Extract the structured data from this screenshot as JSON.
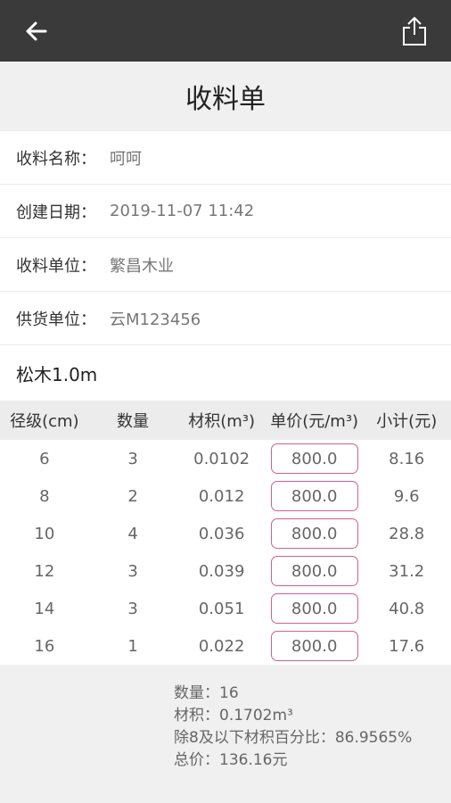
{
  "header": {
    "back_icon": "arrow-left-icon",
    "share_icon": "share-icon",
    "title": "收料单"
  },
  "info": [
    {
      "label": "收料名称：",
      "value": "呵呵"
    },
    {
      "label": "创建日期：",
      "value": "2019-11-07 11:42"
    },
    {
      "label": "收料单位：",
      "value": "繁昌木业"
    },
    {
      "label": "供货单位：",
      "value": "云M123456"
    }
  ],
  "section_title": "松木1.0m",
  "table": {
    "headers": [
      "径级(cm)",
      "数量",
      "材积(m³)",
      "单价(元/m³)",
      "小计(元)"
    ],
    "rows": [
      {
        "diameter": "6",
        "qty": "3",
        "volume": "0.0102",
        "price": "800.0",
        "subtotal": "8.16"
      },
      {
        "diameter": "8",
        "qty": "2",
        "volume": "0.012",
        "price": "800.0",
        "subtotal": "9.6"
      },
      {
        "diameter": "10",
        "qty": "4",
        "volume": "0.036",
        "price": "800.0",
        "subtotal": "28.8"
      },
      {
        "diameter": "12",
        "qty": "3",
        "volume": "0.039",
        "price": "800.0",
        "subtotal": "31.2"
      },
      {
        "diameter": "14",
        "qty": "3",
        "volume": "0.051",
        "price": "800.0",
        "subtotal": "40.8"
      },
      {
        "diameter": "16",
        "qty": "1",
        "volume": "0.022",
        "price": "800.0",
        "subtotal": "17.6"
      }
    ]
  },
  "summary": {
    "quantity": "数量：16",
    "volume": "材积：0.1702m³",
    "percent": "除8及以下材积百分比：86.9565%",
    "total": "总价：136.16元"
  },
  "colors": {
    "topbar": "#3a3a3a",
    "input_border": "#d06090"
  }
}
